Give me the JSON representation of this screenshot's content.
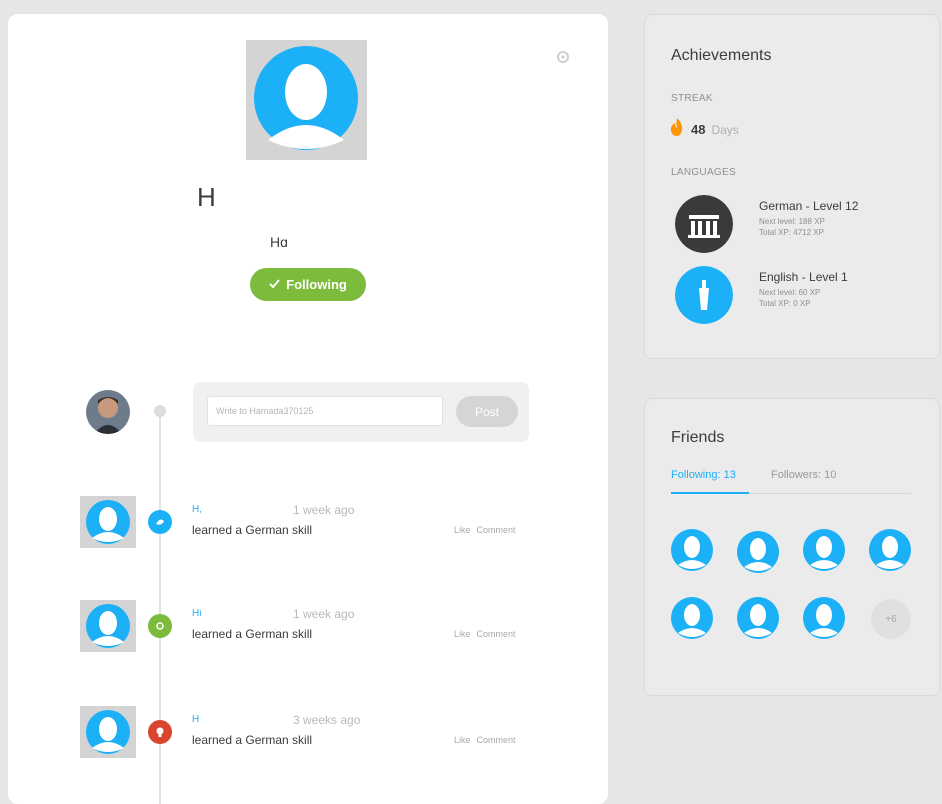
{
  "profile": {
    "display_name": "H",
    "username": "Hɑ",
    "follow_button": "Following"
  },
  "composer": {
    "placeholder": "Write to Hamada370125",
    "post_label": "Post"
  },
  "feed": [
    {
      "user": "H,",
      "time": "1 week ago",
      "text": "learned a German skill",
      "like": "Like",
      "comment": "Comment",
      "dot_color": "#1cb0f6"
    },
    {
      "user": "Hı",
      "time": "1 week ago",
      "text": "learned a German skill",
      "like": "Like",
      "comment": "Comment",
      "dot_color": "#7dbb3d"
    },
    {
      "user": "H",
      "time": "3 weeks ago",
      "text": "learned a German skill",
      "like": "Like",
      "comment": "Comment",
      "dot_color": "#d9452c"
    }
  ],
  "achievements": {
    "title": "Achievements",
    "streak_label": "STREAK",
    "streak_value": "48",
    "streak_unit": "Days",
    "languages_label": "LANGUAGES",
    "languages": [
      {
        "name": "German - Level 12",
        "next": "Next level: 188 XP",
        "total": "Total XP: 4712 XP",
        "icon": "brandenburg-gate-icon"
      },
      {
        "name": "English - Level 1",
        "next": "Next level: 60 XP",
        "total": "Total XP: 0 XP",
        "icon": "statue-of-liberty-icon"
      }
    ]
  },
  "friends": {
    "title": "Friends",
    "tab_following": "Following: 13",
    "tab_followers": "Followers: 10",
    "more_label": "+6"
  },
  "colors": {
    "accent_blue": "#1cb0f6",
    "follow_green": "#7dbb3d",
    "flame_orange": "#ff9600"
  }
}
